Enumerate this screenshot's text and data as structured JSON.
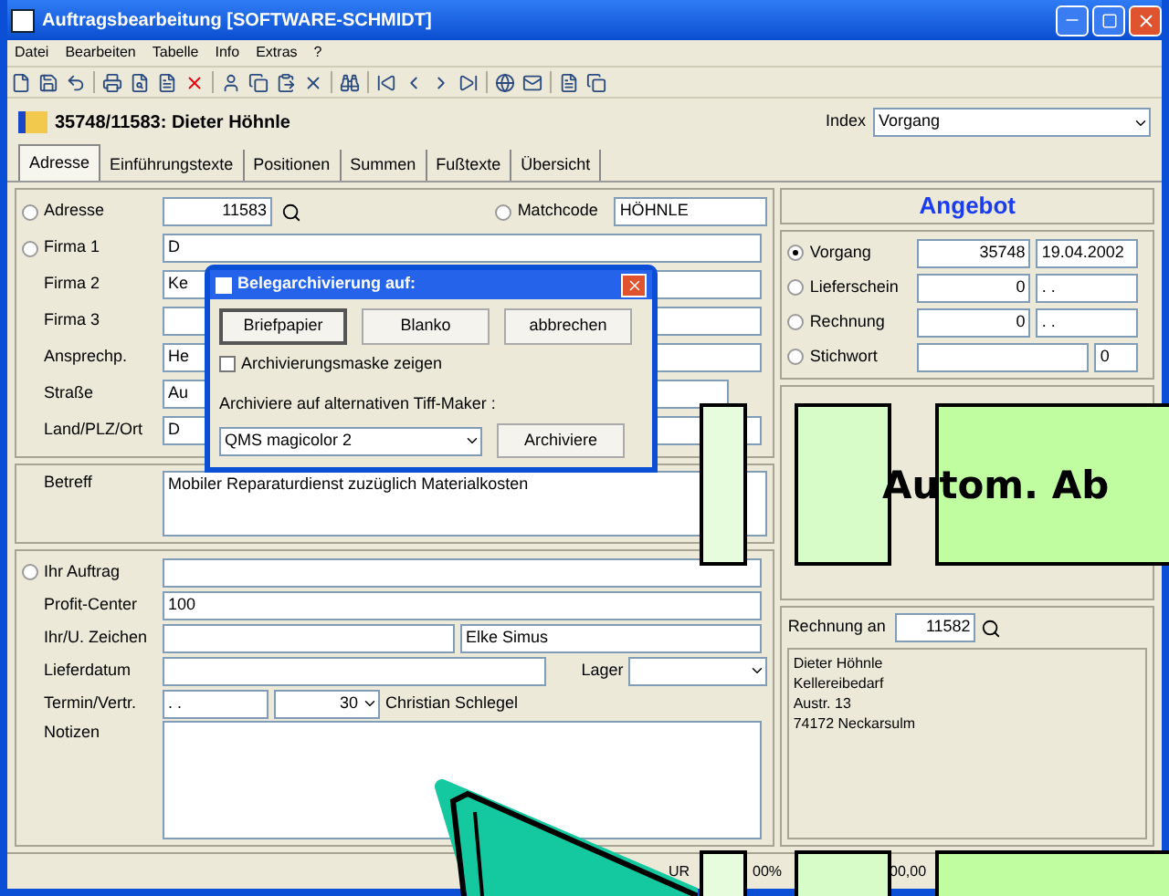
{
  "window": {
    "title": "Auftragsbearbeitung [SOFTWARE-SCHMIDT]"
  },
  "menu": [
    "Datei",
    "Bearbeiten",
    "Tabelle",
    "Info",
    "Extras",
    "?"
  ],
  "header": {
    "title": "35748/11583: Dieter Höhnle",
    "index_label": "Index",
    "index_value": "Vorgang"
  },
  "tabs": [
    {
      "label": "Adresse",
      "selected": true
    },
    {
      "label": "Einführungstexte",
      "selected": false
    },
    {
      "label": "Positionen",
      "selected": false
    },
    {
      "label": "Summen",
      "selected": false
    },
    {
      "label": "Fußtexte",
      "selected": false
    },
    {
      "label": "Übersicht",
      "selected": false
    }
  ],
  "address": {
    "radio_label": "Adresse",
    "radio_selected": false,
    "number": "11583",
    "matchcode_label": "Matchcode",
    "matchcode_selected": false,
    "matchcode": "HÖHNLE",
    "rows": [
      {
        "label": "Firma 1",
        "kind": "radio",
        "selected": false,
        "value": "D"
      },
      {
        "label": "Firma 2",
        "kind": "text",
        "value": "Ke"
      },
      {
        "label": "Firma 3",
        "kind": "text",
        "value": ""
      },
      {
        "label": "Ansprechp.",
        "kind": "text",
        "value": "He"
      },
      {
        "label": "Straße",
        "kind": "text",
        "value": "Au"
      },
      {
        "label": "Land/PLZ/Ort",
        "kind": "text",
        "value": "D"
      }
    ]
  },
  "dialog": {
    "title": "Belegarchivierung auf:",
    "buttons": [
      {
        "label": "Briefpapier",
        "selected": true
      },
      {
        "label": "Blanko",
        "selected": false
      },
      {
        "label": "abbrechen",
        "selected": false
      }
    ],
    "checkbox": {
      "label": "Archivierungsmaske zeigen",
      "checked": false
    },
    "alt_label": "Archiviere auf alternativen Tiff-Maker :",
    "printer": "QMS magicolor 2",
    "archive_button": "Archiviere"
  },
  "subject": {
    "label": "Betreff",
    "value": "Mobiler Reparaturdienst zuzüglich Materialkosten"
  },
  "order": {
    "radio_label": "Ihr Auftrag",
    "radio_selected": false,
    "profit_label": "Profit-Center",
    "profit": "100",
    "sign_label": "Ihr/U. Zeichen",
    "sign_value": "Elke Simus",
    "delivery_label": "Lieferdatum",
    "stock_label": "Lager",
    "appointment_label": "Termin/Vertr.",
    "appointment_date": ". .",
    "days": "30",
    "agent": "Christian Schlegel",
    "notes_label": "Notizen"
  },
  "document": {
    "title": "Angebot",
    "rows": [
      {
        "label": "Vorgang",
        "selected": true,
        "number": "35748",
        "date": "19.04.2002"
      },
      {
        "label": "Lieferschein",
        "selected": false,
        "number": "0",
        "date": ". ."
      },
      {
        "label": "Rechnung",
        "selected": false,
        "number": "0",
        "date": ". ."
      },
      {
        "label": "Stichwort",
        "selected": false,
        "number": "",
        "date": "0"
      }
    ]
  },
  "invoice": {
    "label": "Rechnung an",
    "number": "11582",
    "lines": [
      "Dieter Höhnle",
      "Kellereibedarf",
      "Austr. 13",
      "74172 Neckarsulm"
    ]
  },
  "status_bar": [
    "UR",
    "00%",
    "00,00"
  ],
  "overlay": {
    "caption": "Autom. Ab"
  }
}
